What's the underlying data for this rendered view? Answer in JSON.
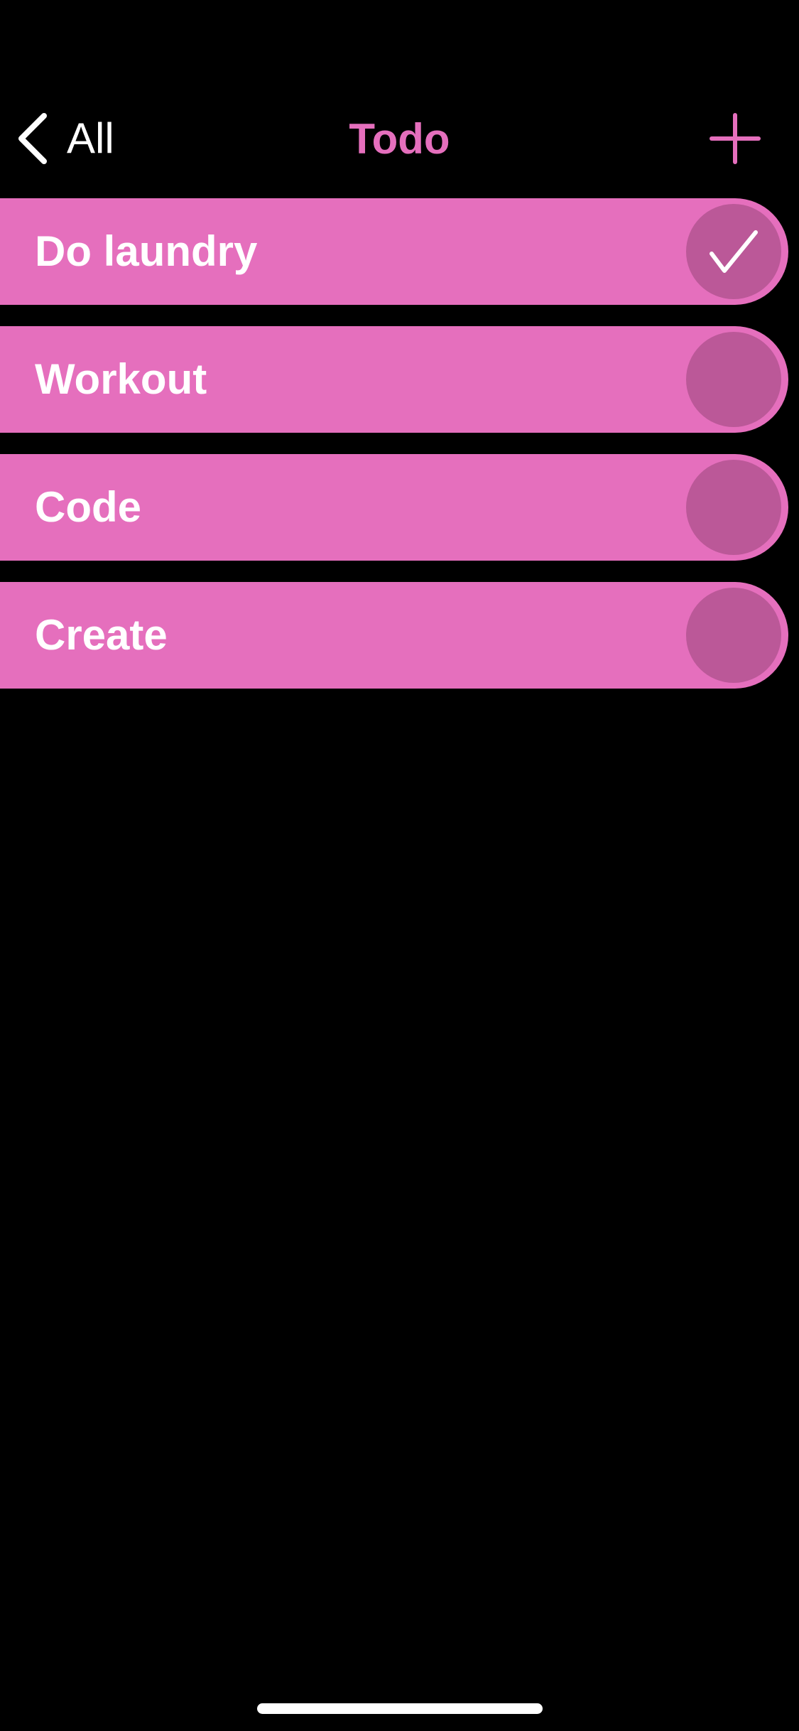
{
  "nav": {
    "back_label": "All",
    "title": "Todo",
    "back_icon": "chevron-left-icon",
    "add_icon": "plus-icon"
  },
  "colors": {
    "background": "#000000",
    "accent": "#e56fbd",
    "check_circle": "#bb5898",
    "text": "#ffffff"
  },
  "todos": [
    {
      "label": "Do laundry",
      "done": true
    },
    {
      "label": "Workout",
      "done": false
    },
    {
      "label": "Code",
      "done": false
    },
    {
      "label": "Create",
      "done": false
    }
  ]
}
